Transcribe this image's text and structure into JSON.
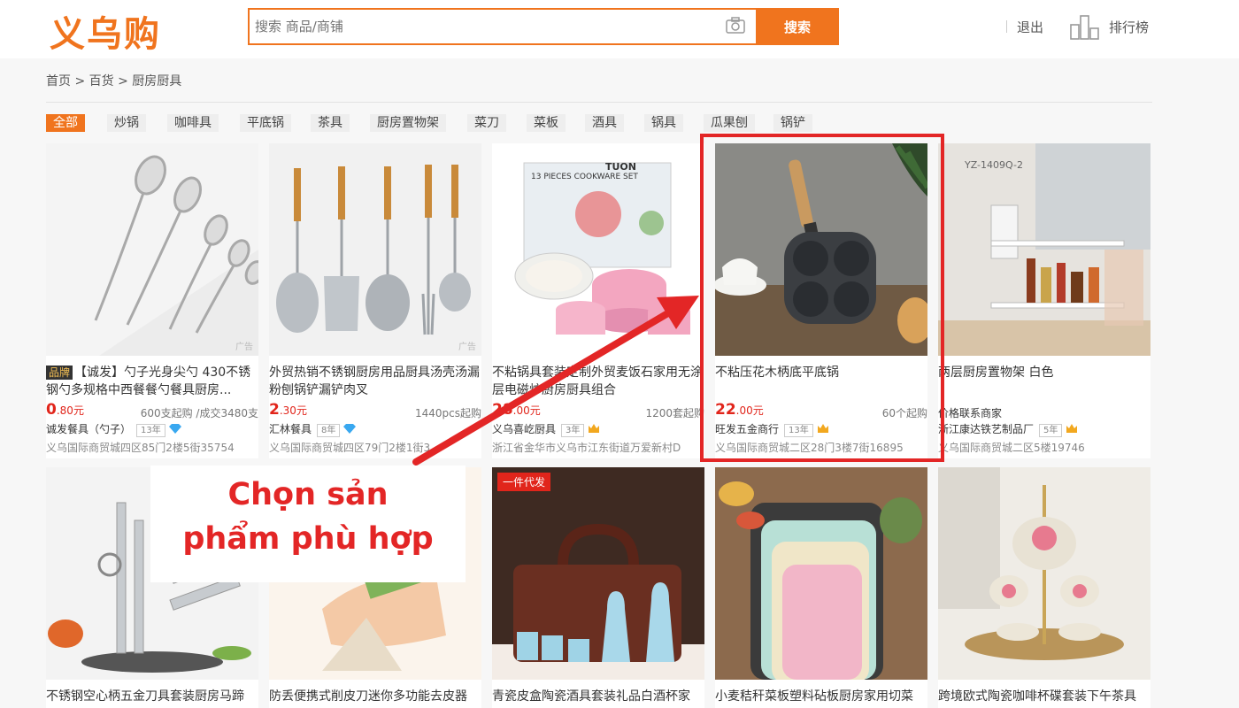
{
  "header": {
    "logo_text": "义乌购",
    "search_placeholder": "搜索 商品/商铺",
    "search_button": "搜索",
    "logout": "退出",
    "ranking": "排行榜"
  },
  "breadcrumb": {
    "home": "首页",
    "sep1": " > ",
    "level1": "百货",
    "sep2": " > ",
    "level2": "厨房厨具"
  },
  "tabs": [
    "全部",
    "炒锅",
    "咖啡具",
    "平底锅",
    "茶具",
    "厨房置物架",
    "菜刀",
    "菜板",
    "酒具",
    "锅具",
    "瓜果刨",
    "锅铲"
  ],
  "products_row1": [
    {
      "brand_tag": "品牌",
      "title": "【诚发】勺子光身尖勺 430不锈钢勺多规格中西餐餐勺餐具厨房...",
      "price_int": "0",
      "price_dec": ".80",
      "currency": "元",
      "moq": "600支起购 /成交3480支",
      "shop": "诚发餐具（勺子）",
      "years": "13年",
      "badge": "diamond",
      "addr": "义乌国际商贸城四区85门2楼5街35754",
      "ad": "广告"
    },
    {
      "brand_tag": "",
      "title": "外贸热销不锈钢厨房用品厨具汤壳汤漏粉刨锅铲漏铲肉叉",
      "price_int": "2",
      "price_dec": ".30",
      "currency": "元",
      "moq": "1440pcs起购",
      "shop": "汇林餐具",
      "years": "8年",
      "badge": "diamond",
      "addr": "义乌国际商贸城四区79门2楼1街3",
      "ad": "广告"
    },
    {
      "brand_tag": "",
      "title": "不粘锅具套装定制外贸麦饭石家用无涂层电磁炉厨房厨具组合",
      "price_int": "28",
      "price_dec": ".00",
      "currency": "元",
      "moq": "1200套起购",
      "shop": "义乌喜屹厨具",
      "years": "3年",
      "badge": "crown",
      "addr": "浙江省金华市义乌市江东街道万爱新村D",
      "ad": ""
    },
    {
      "brand_tag": "",
      "title": "不粘压花木柄底平底锅",
      "price_int": "22",
      "price_dec": ".00",
      "currency": "元",
      "moq": "60个起购",
      "shop": "旺发五金商行",
      "years": "13年",
      "badge": "crown",
      "addr": "义乌国际商贸城二区28门3楼7街16895",
      "ad": ""
    },
    {
      "brand_tag": "",
      "title": "两层厨房置物架 白色",
      "price_int": "",
      "price_dec": "",
      "currency": "",
      "moq": "",
      "shop": "价格联系商家",
      "years": "",
      "badge": "",
      "addr": "",
      "ad": ""
    }
  ],
  "product5_extra": {
    "shop": "浙江康达铁艺制品厂",
    "years": "5年",
    "addr": "义乌国际商贸城二区5楼19746"
  },
  "products_row2": [
    {
      "title": "不锈钢空心柄五金刀具套装厨房马蹄"
    },
    {
      "title": "防丢便携式削皮刀迷你多功能去皮器"
    },
    {
      "title": "青瓷皮盒陶瓷酒具套装礼品白酒杯家",
      "promo": "一件代发"
    },
    {
      "title": "小麦秸秆菜板塑料砧板厨房家用切菜"
    },
    {
      "title": "跨境欧式陶瓷咖啡杯碟套装下午茶具"
    }
  ],
  "annotation": {
    "line1": "Chọn sản",
    "line2": "phẩm phù hợp"
  },
  "colors": {
    "accent": "#f0741e",
    "price": "#e1251b",
    "highlight": "#e32626"
  }
}
